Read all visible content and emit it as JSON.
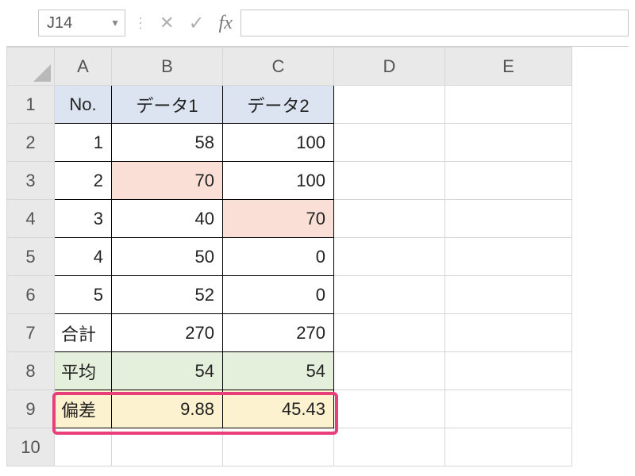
{
  "formula_bar": {
    "cell_ref": "J14",
    "fx_label": "fx",
    "formula": ""
  },
  "columns": [
    "A",
    "B",
    "C",
    "D",
    "E"
  ],
  "row_numbers": [
    "1",
    "2",
    "3",
    "4",
    "5",
    "6",
    "7",
    "8",
    "9",
    "10"
  ],
  "header_row": {
    "A": "No.",
    "B": "データ1",
    "C": "データ2"
  },
  "data_rows": [
    {
      "A": "1",
      "B": "58",
      "C": "100"
    },
    {
      "A": "2",
      "B": "70",
      "C": "100"
    },
    {
      "A": "3",
      "B": "40",
      "C": "70"
    },
    {
      "A": "4",
      "B": "50",
      "C": "0"
    },
    {
      "A": "5",
      "B": "52",
      "C": "0"
    }
  ],
  "summary": {
    "total": {
      "label": "合計",
      "B": "270",
      "C": "270"
    },
    "average": {
      "label": "平均",
      "B": "54",
      "C": "54"
    },
    "stdev": {
      "label": "偏差",
      "B": "9.88",
      "C": "45.43"
    }
  },
  "chart_data": {
    "type": "table",
    "title": "",
    "columns": [
      "No.",
      "データ1",
      "データ2"
    ],
    "rows": [
      [
        1,
        58,
        100
      ],
      [
        2,
        70,
        100
      ],
      [
        3,
        40,
        70
      ],
      [
        4,
        50,
        0
      ],
      [
        5,
        52,
        0
      ]
    ],
    "aggregates": {
      "合計": [
        270,
        270
      ],
      "平均": [
        54,
        54
      ],
      "偏差": [
        9.88,
        45.43
      ]
    }
  }
}
